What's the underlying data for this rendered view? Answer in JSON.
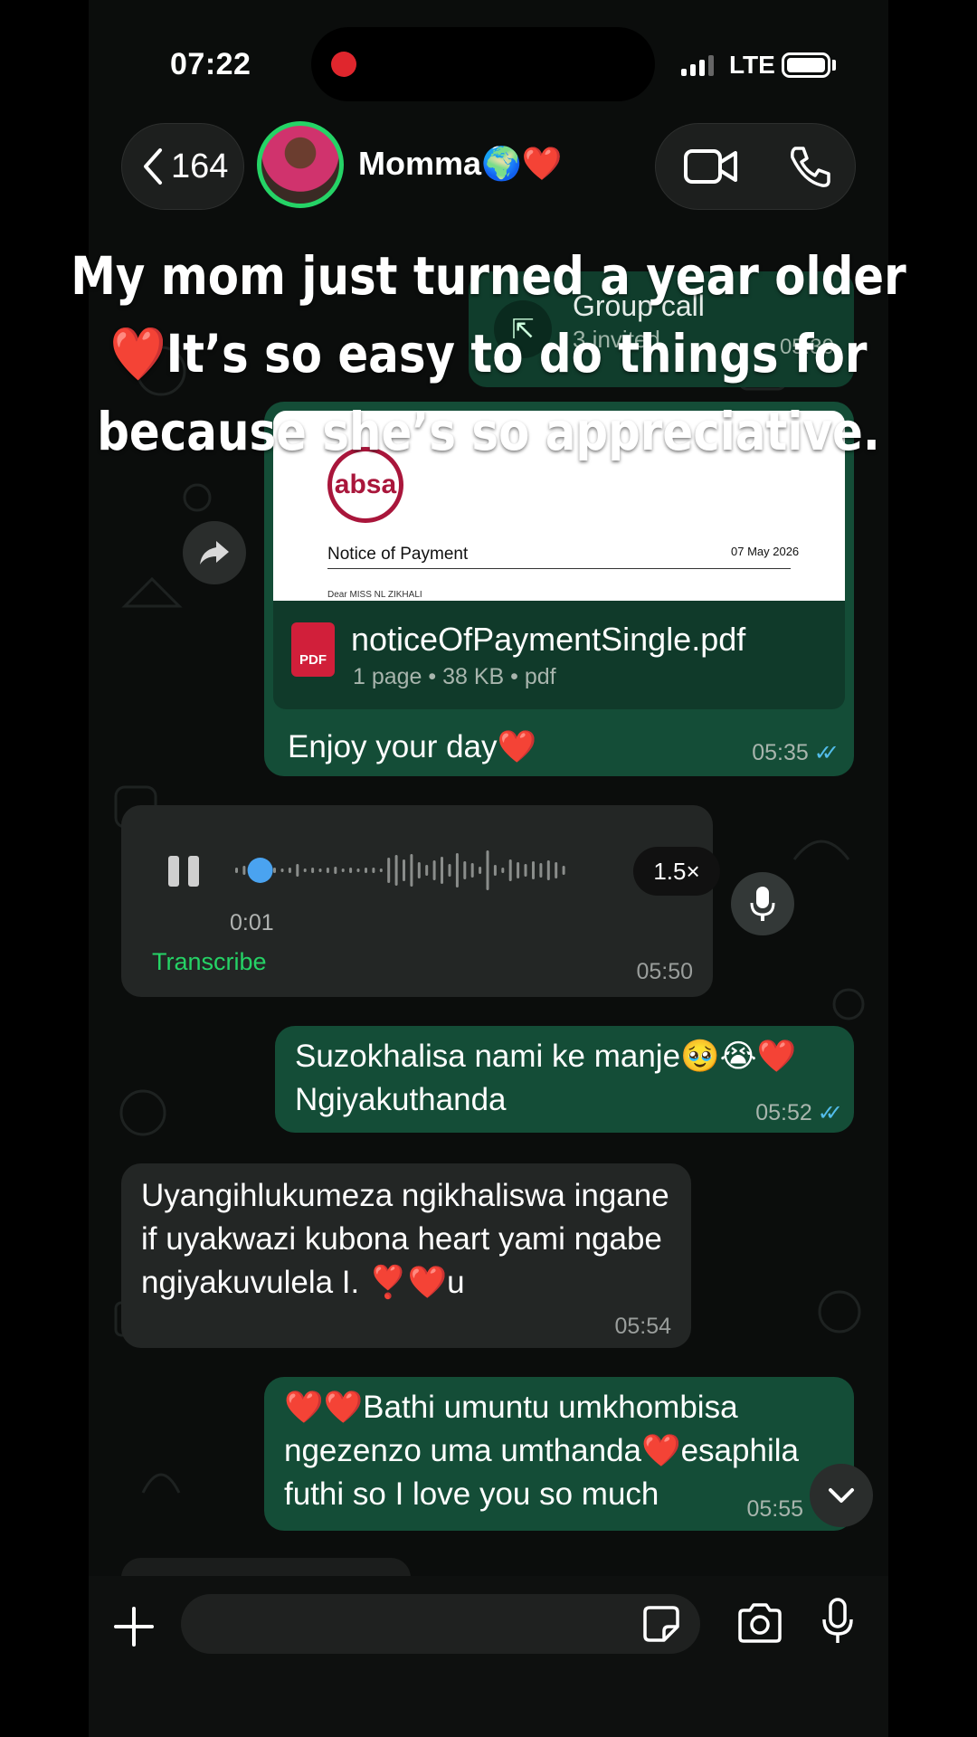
{
  "status_bar": {
    "time": "07:22",
    "network": "LTE"
  },
  "header": {
    "back_count": "164",
    "contact_name": "Momma🌍❤️"
  },
  "caption_overlay": [
    "My mom just turned a year older",
    "❤️It’s so easy to do things for",
    "because she’s so appreciative."
  ],
  "group_call": {
    "title": "Group call",
    "subtitle": "3 invited",
    "time": "05:30"
  },
  "pdf_message": {
    "preview_title": "Notice of Payment",
    "preview_date": "07 May 2026",
    "preview_greeting": "Dear MISS NL ZIKHALI",
    "logo_text": "absa",
    "file_name": "noticeOfPaymentSingle.pdf",
    "file_meta": "1 page • 38 KB • pdf",
    "icon_label": "PDF",
    "caption": "Enjoy your day❤️",
    "time": "05:35"
  },
  "voice_message": {
    "duration": "0:01",
    "speed": "1.5×",
    "transcribe_label": "Transcribe",
    "time": "05:50",
    "progress": 0.04
  },
  "messages": [
    {
      "direction": "out",
      "text": "Suzokhalisa nami ke manje🥹😭❤️ Ngiyakuthanda",
      "time": "05:52"
    },
    {
      "direction": "in",
      "text": "Uyangihlukumeza ngikhaliswa ingane  if uyakwazi kubona heart yami ngabe ngiyakuvulela I.  ❣️❤️u",
      "time": "05:54"
    },
    {
      "direction": "out",
      "text": "❤️❤️Bathi umuntu umkhombisa ngezenzo uma umthanda❤️esaphila futhi so I love you so much",
      "time": "05:55"
    }
  ],
  "input": {
    "placeholder": ""
  },
  "colors": {
    "outgoing_bubble": "#144d37",
    "incoming_bubble": "#232625",
    "accent_green": "#25d366",
    "read_ticks": "#53bdeb"
  }
}
